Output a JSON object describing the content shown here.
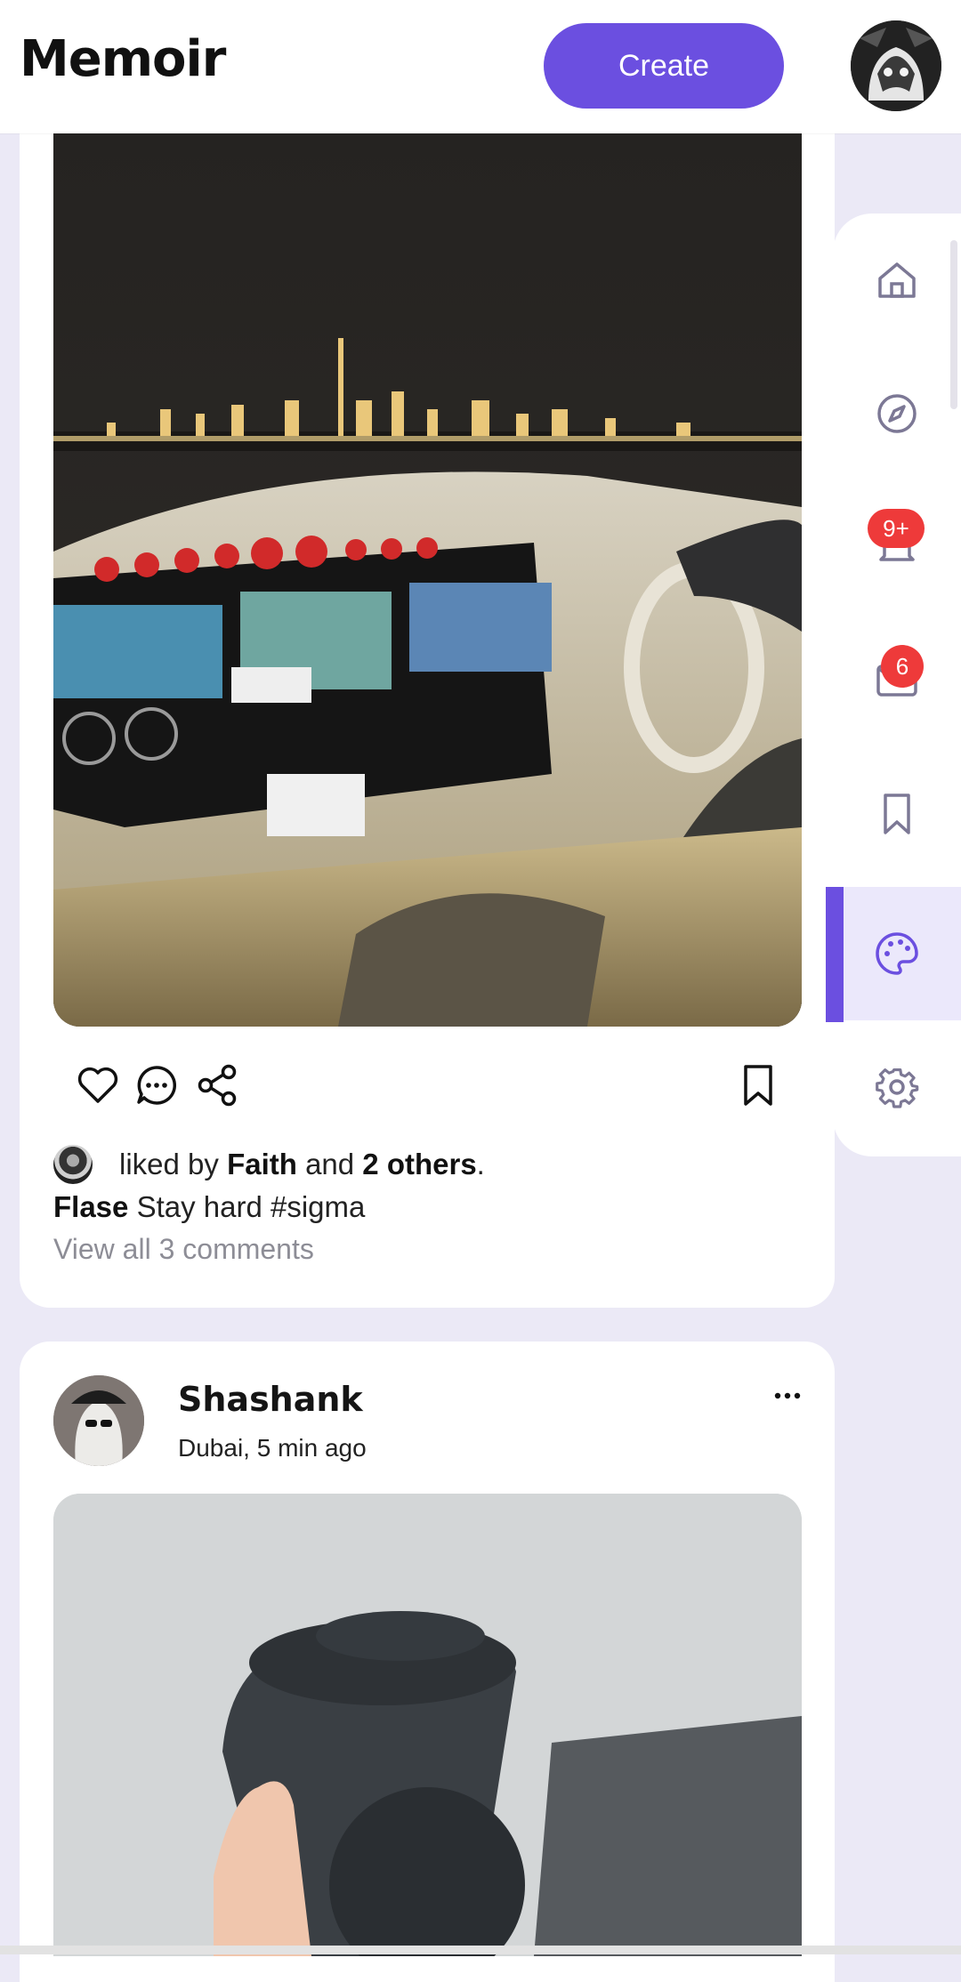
{
  "header": {
    "brand": "Memoir",
    "create_label": "Create"
  },
  "colors": {
    "accent": "#6b4fe0",
    "badge": "#ee3a3a",
    "background": "#ebe9f6"
  },
  "sidebar": {
    "items": [
      {
        "name": "home",
        "icon": "home-icon"
      },
      {
        "name": "explore",
        "icon": "compass-icon"
      },
      {
        "name": "notifications",
        "icon": "bell-icon",
        "badge": "9+"
      },
      {
        "name": "messages",
        "icon": "mail-icon",
        "badge": "6"
      },
      {
        "name": "saved",
        "icon": "bookmark-icon"
      },
      {
        "name": "themes",
        "icon": "palette-icon",
        "active": true
      },
      {
        "name": "settings",
        "icon": "gear-icon"
      }
    ]
  },
  "post1": {
    "liked_prefix": "liked by",
    "liked_name": "Faith",
    "liked_and": "and",
    "liked_others": "2 others",
    "liked_suffix": ".",
    "caption_user": "Flase",
    "caption_text": "Stay hard #sigma",
    "view_comments": "View all 3 comments"
  },
  "post2": {
    "username": "Shashank",
    "location": "Dubai, 5 min ago"
  }
}
